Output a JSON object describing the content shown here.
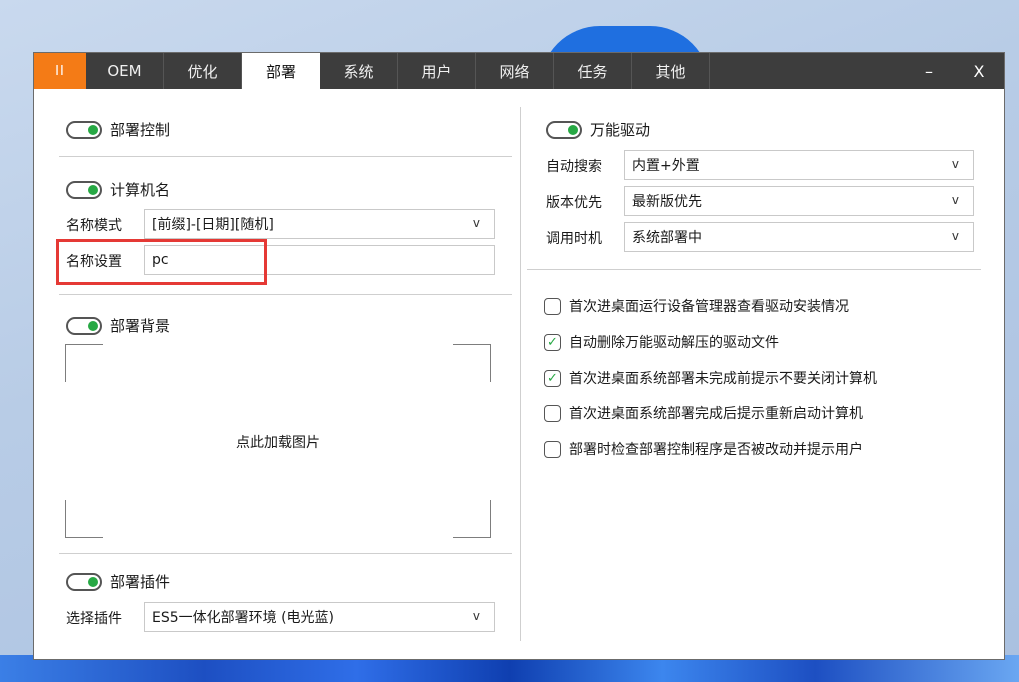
{
  "titlebar": {
    "pause_label": "II",
    "tabs": [
      "OEM",
      "优化",
      "部署",
      "系统",
      "用户",
      "网络",
      "任务",
      "其他"
    ],
    "active_tab": "部署",
    "minimize_label": "–",
    "close_label": "X"
  },
  "deploy_control": {
    "label": "部署控制",
    "enabled": true
  },
  "computer_name": {
    "label": "计算机名",
    "enabled": true,
    "mode_label": "名称模式",
    "mode_value": "[前缀]-[日期][随机]",
    "setting_label": "名称设置",
    "setting_value": "pc"
  },
  "deploy_background": {
    "label": "部署背景",
    "enabled": true,
    "image_prompt": "点此加载图片"
  },
  "deploy_plugin": {
    "label": "部署插件",
    "enabled": true,
    "select_label": "选择插件",
    "select_value": "ES5一体化部署环境 (电光蓝)"
  },
  "universal_driver": {
    "label": "万能驱动",
    "enabled": true,
    "auto_search_label": "自动搜索",
    "auto_search_value": "内置+外置",
    "version_priority_label": "版本优先",
    "version_priority_value": "最新版优先",
    "invoke_timing_label": "调用时机",
    "invoke_timing_value": "系统部署中"
  },
  "options": [
    {
      "label": "首次进桌面运行设备管理器查看驱动安装情况",
      "checked": false
    },
    {
      "label": "自动删除万能驱动解压的驱动文件",
      "checked": true
    },
    {
      "label": "首次进桌面系统部署未完成前提示不要关闭计算机",
      "checked": true
    },
    {
      "label": "首次进桌面系统部署完成后提示重新启动计算机",
      "checked": false
    },
    {
      "label": "部署时检查部署控制程序是否被改动并提示用户",
      "checked": false
    }
  ],
  "icons": {
    "dropdown": "chevron-down-icon",
    "check": "checkmark-icon"
  },
  "colors": {
    "accent_orange": "#f47b16",
    "toggle_green": "#27a844",
    "highlight_red": "#e53935",
    "titlebar": "#3d3d3d"
  }
}
